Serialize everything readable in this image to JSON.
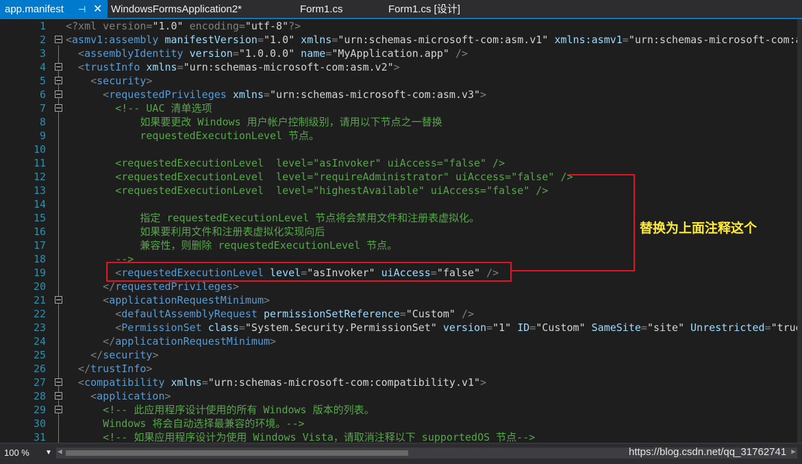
{
  "tabs": [
    {
      "label": "app.manifest",
      "pin": "⊣",
      "close": "✕",
      "active": true
    },
    {
      "label": "WindowsFormsApplication2*"
    },
    {
      "label": "Form1.cs"
    },
    {
      "label": "Form1.cs [设计]"
    }
  ],
  "lines": [
    {
      "n": "1",
      "fold": false,
      "segs": [
        [
          "xd",
          "<?xml version="
        ],
        [
          "av",
          "\"1.0\""
        ],
        [
          "xd",
          " encoding="
        ],
        [
          "av",
          "\"utf-8\""
        ],
        [
          "xd",
          "?>"
        ]
      ]
    },
    {
      "n": "2",
      "fold": true,
      "segs": [
        [
          "xd",
          "<"
        ],
        [
          "en",
          "asmv1:assembly"
        ],
        [
          "an",
          " manifestVersion"
        ],
        [
          "xd",
          "="
        ],
        [
          "av",
          "\"1.0\""
        ],
        [
          "an",
          " xmlns"
        ],
        [
          "xd",
          "="
        ],
        [
          "av",
          "\"urn:schemas-microsoft-com:asm.v1\""
        ],
        [
          "an",
          " xmlns:asmv1"
        ],
        [
          "xd",
          "="
        ],
        [
          "av",
          "\"urn:schemas-microsoft-com:a"
        ]
      ]
    },
    {
      "n": "3",
      "fold": false,
      "segs": [
        [
          "xd",
          "  <"
        ],
        [
          "en",
          "assemblyIdentity"
        ],
        [
          "an",
          " version"
        ],
        [
          "xd",
          "="
        ],
        [
          "av",
          "\"1.0.0.0\""
        ],
        [
          "an",
          " name"
        ],
        [
          "xd",
          "="
        ],
        [
          "av",
          "\"MyApplication.app\""
        ],
        [
          "xd",
          " />"
        ]
      ]
    },
    {
      "n": "4",
      "fold": true,
      "segs": [
        [
          "xd",
          "  <"
        ],
        [
          "en",
          "trustInfo"
        ],
        [
          "an",
          " xmlns"
        ],
        [
          "xd",
          "="
        ],
        [
          "av",
          "\"urn:schemas-microsoft-com:asm.v2\""
        ],
        [
          "xd",
          ">"
        ]
      ]
    },
    {
      "n": "5",
      "fold": true,
      "segs": [
        [
          "xd",
          "    <"
        ],
        [
          "en",
          "security"
        ],
        [
          "xd",
          ">"
        ]
      ]
    },
    {
      "n": "6",
      "fold": true,
      "segs": [
        [
          "xd",
          "      <"
        ],
        [
          "en",
          "requestedPrivileges"
        ],
        [
          "an",
          " xmlns"
        ],
        [
          "xd",
          "="
        ],
        [
          "av",
          "\"urn:schemas-microsoft-com:asm.v3\""
        ],
        [
          "xd",
          ">"
        ]
      ]
    },
    {
      "n": "7",
      "fold": true,
      "segs": [
        [
          "cm",
          "        <!-- UAC 清单选项"
        ]
      ]
    },
    {
      "n": "8",
      "fold": false,
      "segs": [
        [
          "cm",
          "            如果要更改 Windows 用户帐户控制级别，请用以下节点之一替换"
        ]
      ]
    },
    {
      "n": "9",
      "fold": false,
      "segs": [
        [
          "cm",
          "            requestedExecutionLevel 节点。"
        ]
      ]
    },
    {
      "n": "10",
      "fold": false,
      "segs": []
    },
    {
      "n": "11",
      "fold": false,
      "segs": [
        [
          "cm",
          "        <requestedExecutionLevel  level=\"asInvoker\" uiAccess=\"false\" />"
        ]
      ]
    },
    {
      "n": "12",
      "fold": false,
      "segs": [
        [
          "cm",
          "        <requestedExecutionLevel  level=\"requireAdministrator\" uiAccess=\"false\" />"
        ]
      ]
    },
    {
      "n": "13",
      "fold": false,
      "segs": [
        [
          "cm",
          "        <requestedExecutionLevel  level=\"highestAvailable\" uiAccess=\"false\" />"
        ]
      ]
    },
    {
      "n": "14",
      "fold": false,
      "segs": []
    },
    {
      "n": "15",
      "fold": false,
      "segs": [
        [
          "cm",
          "            指定 requestedExecutionLevel 节点将会禁用文件和注册表虚拟化。"
        ]
      ]
    },
    {
      "n": "16",
      "fold": false,
      "segs": [
        [
          "cm",
          "            如果要利用文件和注册表虚拟化实现向后"
        ]
      ]
    },
    {
      "n": "17",
      "fold": false,
      "segs": [
        [
          "cm",
          "            兼容性，则删除 requestedExecutionLevel 节点。"
        ]
      ]
    },
    {
      "n": "18",
      "fold": false,
      "segs": [
        [
          "cm",
          "        -->"
        ]
      ]
    },
    {
      "n": "19",
      "fold": false,
      "segs": [
        [
          "xd",
          "        <"
        ],
        [
          "en",
          "requestedExecutionLevel"
        ],
        [
          "an",
          " level"
        ],
        [
          "xd",
          "="
        ],
        [
          "av",
          "\"asInvoker\""
        ],
        [
          "an",
          " uiAccess"
        ],
        [
          "xd",
          "="
        ],
        [
          "av",
          "\"false\""
        ],
        [
          "xd",
          " />"
        ]
      ]
    },
    {
      "n": "20",
      "fold": false,
      "segs": [
        [
          "xd",
          "      </"
        ],
        [
          "en",
          "requestedPrivileges"
        ],
        [
          "xd",
          ">"
        ]
      ]
    },
    {
      "n": "21",
      "fold": true,
      "segs": [
        [
          "xd",
          "      <"
        ],
        [
          "en",
          "applicationRequestMinimum"
        ],
        [
          "xd",
          ">"
        ]
      ]
    },
    {
      "n": "22",
      "fold": false,
      "segs": [
        [
          "xd",
          "        <"
        ],
        [
          "en",
          "defaultAssemblyRequest"
        ],
        [
          "an",
          " permissionSetReference"
        ],
        [
          "xd",
          "="
        ],
        [
          "av",
          "\"Custom\""
        ],
        [
          "xd",
          " />"
        ]
      ]
    },
    {
      "n": "23",
      "fold": false,
      "segs": [
        [
          "xd",
          "        <"
        ],
        [
          "en",
          "PermissionSet"
        ],
        [
          "an",
          " class"
        ],
        [
          "xd",
          "="
        ],
        [
          "av",
          "\"System.Security.PermissionSet\""
        ],
        [
          "an",
          " version"
        ],
        [
          "xd",
          "="
        ],
        [
          "av",
          "\"1\""
        ],
        [
          "an",
          " ID"
        ],
        [
          "xd",
          "="
        ],
        [
          "av",
          "\"Custom\""
        ],
        [
          "an",
          " SameSite"
        ],
        [
          "xd",
          "="
        ],
        [
          "av",
          "\"site\""
        ],
        [
          "an",
          " Unrestricted"
        ],
        [
          "xd",
          "="
        ],
        [
          "av",
          "\"true"
        ]
      ]
    },
    {
      "n": "24",
      "fold": false,
      "segs": [
        [
          "xd",
          "      </"
        ],
        [
          "en",
          "applicationRequestMinimum"
        ],
        [
          "xd",
          ">"
        ]
      ]
    },
    {
      "n": "25",
      "fold": false,
      "segs": [
        [
          "xd",
          "    </"
        ],
        [
          "en",
          "security"
        ],
        [
          "xd",
          ">"
        ]
      ]
    },
    {
      "n": "26",
      "fold": false,
      "segs": [
        [
          "xd",
          "  </"
        ],
        [
          "en",
          "trustInfo"
        ],
        [
          "xd",
          ">"
        ]
      ]
    },
    {
      "n": "27",
      "fold": true,
      "segs": [
        [
          "xd",
          "  <"
        ],
        [
          "en",
          "compatibility"
        ],
        [
          "an",
          " xmlns"
        ],
        [
          "xd",
          "="
        ],
        [
          "av",
          "\"urn:schemas-microsoft-com:compatibility.v1\""
        ],
        [
          "xd",
          ">"
        ]
      ]
    },
    {
      "n": "28",
      "fold": true,
      "segs": [
        [
          "xd",
          "    <"
        ],
        [
          "en",
          "application"
        ],
        [
          "xd",
          ">"
        ]
      ]
    },
    {
      "n": "29",
      "fold": true,
      "segs": [
        [
          "cm",
          "      <!-- 此应用程序设计使用的所有 Windows 版本的列表。"
        ]
      ]
    },
    {
      "n": "30",
      "fold": false,
      "segs": [
        [
          "cm",
          "      Windows 将会自动选择最兼容的环境。-->"
        ]
      ]
    },
    {
      "n": "31",
      "fold": false,
      "segs": [
        [
          "cm",
          "      <!-- 如果应用程序设计为使用 Windows Vista，请取消注释以下 supportedOS 节点-->"
        ]
      ]
    }
  ],
  "annotation": {
    "text": "替换为上面注释这个",
    "color": "#e81123",
    "text_color": "#ffeb3b"
  },
  "status": {
    "zoom": "100 %",
    "watermark": "https://blog.csdn.net/qq_31762741"
  },
  "colors": {
    "accent": "#007acc",
    "element": "#569cd6",
    "attribute": "#9cdcfe",
    "comment": "#57a64a",
    "line_number": "#2b91af"
  }
}
